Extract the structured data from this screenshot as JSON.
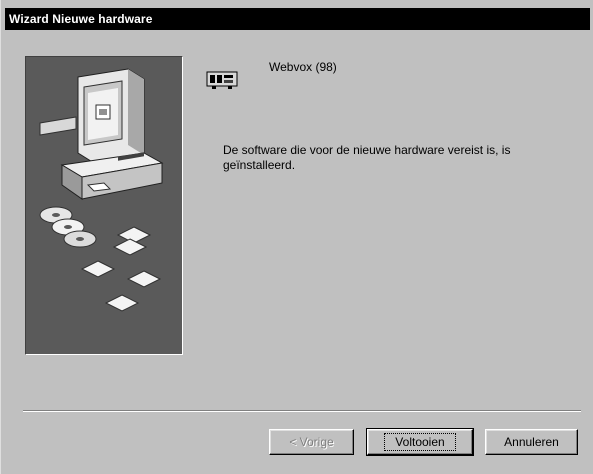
{
  "window": {
    "title": "Wizard Nieuwe hardware"
  },
  "device": {
    "name": "Webvox (98)",
    "icon": "hardware-device-icon"
  },
  "message": "De software die voor de nieuwe hardware vereist is, is geïnstalleerd.",
  "buttons": {
    "back": "< Vorige",
    "finish": "Voltooien",
    "cancel": "Annuleren"
  },
  "illustration": {
    "icon": "computer-with-discs-illustration"
  }
}
